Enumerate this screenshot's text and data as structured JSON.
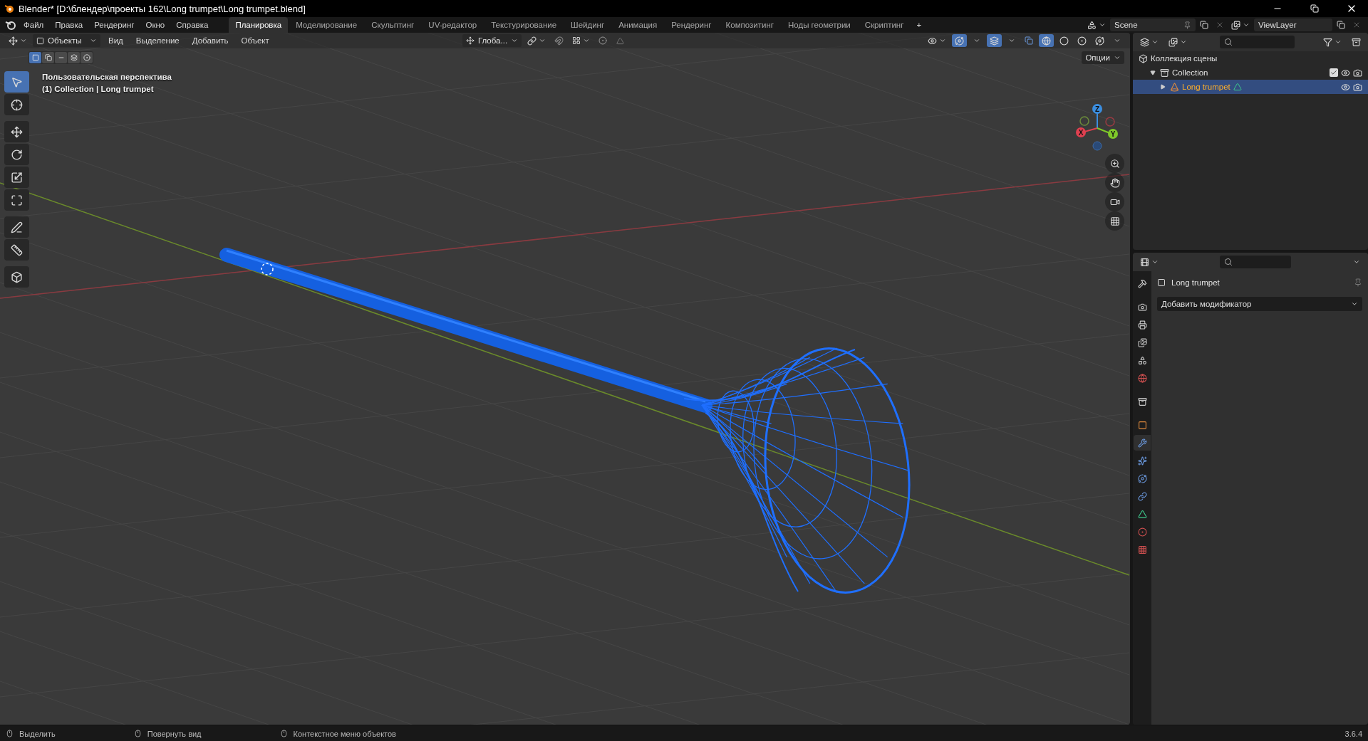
{
  "window": {
    "title": "Blender* [D:\\блендер\\проекты 162\\Long trumpet\\Long trumpet.blend]"
  },
  "menu": [
    "Файл",
    "Правка",
    "Рендеринг",
    "Окно",
    "Справка"
  ],
  "workspaces": [
    {
      "label": "Планировка",
      "selected": true
    },
    {
      "label": "Моделирование",
      "selected": false
    },
    {
      "label": "Скульптинг",
      "selected": false
    },
    {
      "label": "UV-редактор",
      "selected": false
    },
    {
      "label": "Текстурирование",
      "selected": false
    },
    {
      "label": "Шейдинг",
      "selected": false
    },
    {
      "label": "Анимация",
      "selected": false
    },
    {
      "label": "Рендеринг",
      "selected": false
    },
    {
      "label": "Композитинг",
      "selected": false
    },
    {
      "label": "Ноды геометрии",
      "selected": false
    },
    {
      "label": "Скриптинг",
      "selected": false
    }
  ],
  "add_workspace": "+",
  "scene": "Scene",
  "view_layer": "ViewLayer",
  "viewport": {
    "mode": "Объекты",
    "menu": [
      "Вид",
      "Выделение",
      "Добавить",
      "Объект"
    ],
    "orientation": "Глоба...",
    "options": "Опции",
    "overlay_text": [
      "Пользовательская перспектива",
      "(1) Collection | Long trumpet"
    ],
    "select_modes": [
      {
        "kind": "new",
        "selected": true
      },
      {
        "kind": "extend",
        "selected": false
      },
      {
        "kind": "subtract",
        "selected": false
      },
      {
        "kind": "invert",
        "selected": false
      },
      {
        "kind": "intersect",
        "selected": false
      }
    ],
    "tools": [
      {
        "kind": "select",
        "selected": true
      },
      {
        "kind": "cursor",
        "selected": false
      },
      {
        "kind": "move",
        "selected": false
      },
      {
        "kind": "rotate",
        "selected": false
      },
      {
        "kind": "scale",
        "selected": false
      },
      {
        "kind": "transform",
        "selected": false
      },
      {
        "kind": "annotate",
        "selected": false
      },
      {
        "kind": "measure",
        "selected": false
      },
      {
        "kind": "add_cube",
        "selected": false
      }
    ],
    "shading": [
      {
        "kind": "wireframe",
        "selected": true
      },
      {
        "kind": "solid",
        "selected": false
      },
      {
        "kind": "material",
        "selected": false
      },
      {
        "kind": "rendered",
        "selected": false
      }
    ],
    "gizmo_axes": [
      "Z",
      "X",
      "Y"
    ]
  },
  "outliner": {
    "tree": [
      {
        "label": "Коллекция сцены",
        "kind": "scene_collection",
        "selected": false,
        "children": [
          {
            "label": "Collection",
            "kind": "collection",
            "expanded": true,
            "checked": true,
            "selected": false,
            "children": [
              {
                "label": "Long trumpet",
                "kind": "mesh_object",
                "expanded": false,
                "selected": true
              }
            ]
          }
        ]
      }
    ]
  },
  "properties": {
    "object_name": "Long trumpet",
    "add_modifier": "Добавить модификатор",
    "tabs": [
      {
        "kind": "tool",
        "selected": false
      },
      {
        "kind": "render",
        "selected": false
      },
      {
        "kind": "output",
        "selected": false
      },
      {
        "kind": "view_layer",
        "selected": false
      },
      {
        "kind": "scene",
        "selected": false
      },
      {
        "kind": "world",
        "selected": false
      },
      {
        "kind": "collection",
        "selected": false
      },
      {
        "kind": "object",
        "selected": false
      },
      {
        "kind": "modifiers",
        "selected": true
      },
      {
        "kind": "particles",
        "selected": false
      },
      {
        "kind": "physics",
        "selected": false
      },
      {
        "kind": "constraints",
        "selected": false
      },
      {
        "kind": "data",
        "selected": false
      },
      {
        "kind": "material",
        "selected": false
      },
      {
        "kind": "texture",
        "selected": false
      }
    ]
  },
  "status_bar": {
    "hints": [
      "Выделить",
      "Повернуть вид",
      "Контекстное меню объектов"
    ],
    "version": "3.6.4"
  }
}
